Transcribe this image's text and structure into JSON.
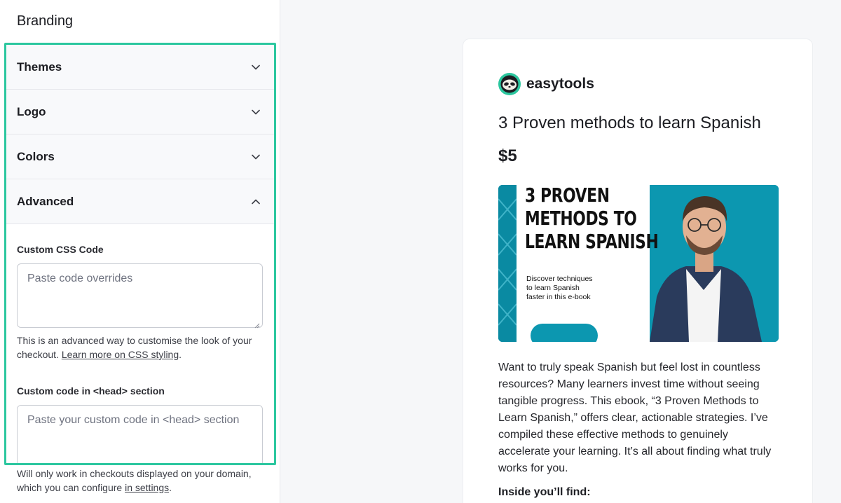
{
  "panel": {
    "title": "Branding",
    "sections": [
      {
        "label": "Themes",
        "expanded": false
      },
      {
        "label": "Logo",
        "expanded": false
      },
      {
        "label": "Colors",
        "expanded": false
      },
      {
        "label": "Advanced",
        "expanded": true
      }
    ],
    "advanced": {
      "css_label": "Custom CSS Code",
      "css_placeholder": "Paste code overrides",
      "css_help_text": "This is an advanced way to customise the look of your checkout.",
      "css_help_link": "Learn more on CSS styling",
      "head_label": "Custom code in <head> section",
      "head_placeholder": "Paste your custom code in <head> section",
      "head_help_text": "Will only work in checkouts displayed on your domain, which you can configure",
      "head_help_link": "in settings"
    }
  },
  "preview": {
    "brand_name": "easytools",
    "product_title": "3 Proven methods to learn Spanish",
    "price": "$5",
    "cover": {
      "headline_lines": [
        "3 PROVEN",
        "METHODS TO",
        "LEARN SPANISH"
      ],
      "sub_lines": [
        "Discover techniques",
        "to learn Spanish",
        "faster in this e-book"
      ]
    },
    "description": "Want to truly speak Spanish but feel lost in countless resources? Many learners invest time without seeing tangible progress. This ebook, “3 Proven Methods to Learn Spanish,” offers clear, actionable strategies. I’ve compiled these effective methods to genuinely accelerate your learning. It’s all about finding what truly works for you.",
    "inside_heading": "Inside you’ll find:"
  },
  "icons": {
    "chevron_down": "chevron-down-icon",
    "chevron_up": "chevron-up-icon",
    "logo": "sloth-logo-icon"
  },
  "colors": {
    "highlight_border": "#2cc79f",
    "cover_teal": "#0c97b0"
  }
}
